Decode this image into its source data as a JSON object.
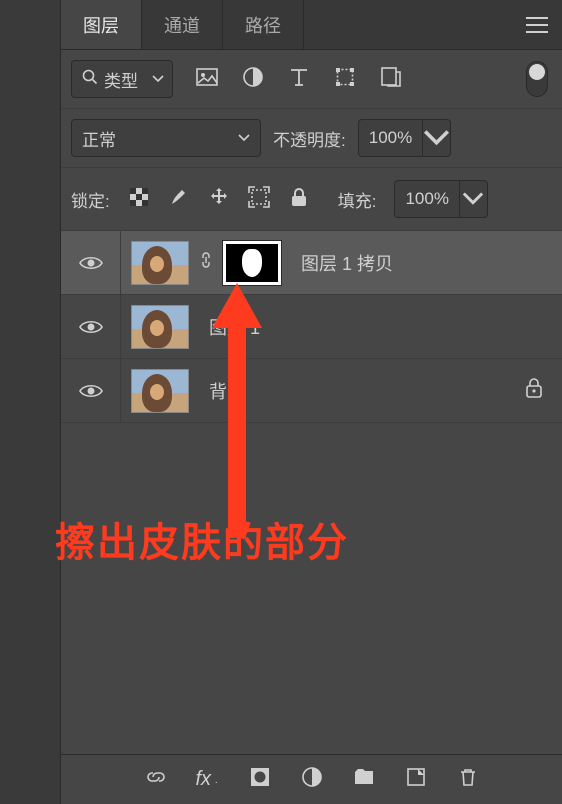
{
  "tabs": {
    "layers": "图层",
    "channels": "通道",
    "paths": "路径"
  },
  "type_filter": {
    "label": "类型"
  },
  "blend": {
    "mode": "正常",
    "opacity_label": "不透明度:",
    "opacity_value": "100%"
  },
  "lock": {
    "label": "锁定:",
    "fill_label": "填充:",
    "fill_value": "100%"
  },
  "layers": [
    {
      "name": "图层 1 拷贝",
      "selected": true,
      "has_mask": true,
      "locked": false
    },
    {
      "name": "图层 1",
      "selected": false,
      "has_mask": false,
      "locked": false
    },
    {
      "name": "背景",
      "selected": false,
      "has_mask": false,
      "locked": true
    }
  ],
  "annotation": {
    "text": "擦出皮肤的部分"
  }
}
